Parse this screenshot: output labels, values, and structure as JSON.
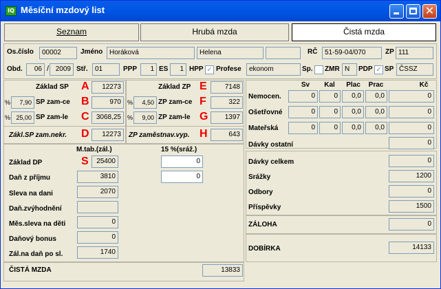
{
  "window": {
    "title": "Měsíční mzdový list",
    "icon_label": "IQ"
  },
  "tabs": [
    {
      "label": "Seznam"
    },
    {
      "label": "Hrubá mzda"
    },
    {
      "label": "Čistá mzda"
    }
  ],
  "employee": {
    "oscislo_label": "Os.číslo",
    "oscislo": "00002",
    "jmeno_label": "Jméno",
    "prijmeni": "Horáková",
    "jmeno": "Helena",
    "extra": "",
    "rc_label": "RČ",
    "rc": "51-59-04/070",
    "zp_label": "ZP",
    "zp": "111",
    "obd_label": "Obd.",
    "month": "06",
    "year": "2009",
    "str_label": "Stř.",
    "str": "01",
    "ppp_label": "PPP",
    "ppp": "1",
    "es_label": "ES",
    "es": "1",
    "hpp_label": "HPP",
    "hpp_checked": true,
    "profese_label": "Profese",
    "profese": "ekonom",
    "sp_label": "Sp.",
    "zmr_label": "ZMR",
    "zmr": "N",
    "pdp_label": "PDP",
    "sp2_label": "SP",
    "sp2": "ČSSZ"
  },
  "sp": {
    "zaklad_label": "Základ SP",
    "zaklad_letter": "A",
    "zaklad": "12273",
    "ce_pct": "7,90",
    "ce_label": "SP zam-ce",
    "ce_letter": "B",
    "ce": "970",
    "le_pct": "25,00",
    "le_label": "SP zam-le",
    "le_letter": "C",
    "le": "3068,25",
    "nekr_label": "Zákl.SP zam.nekr.",
    "nekr_letter": "D",
    "nekr": "12273"
  },
  "zp": {
    "zaklad_label": "Základ ZP",
    "zaklad_letter": "E",
    "zaklad": "7148",
    "ce_pct": "4,50",
    "ce_label": "ZP zam-ce",
    "ce_letter": "F",
    "ce": "322",
    "le_pct": "9,00",
    "le_label": "ZP zam-le",
    "le_letter": "G",
    "le": "1397",
    "vyp_label": "ZP zaměstnav.vyp.",
    "vyp_letter": "H",
    "vyp": "643"
  },
  "percent_symbol": "%",
  "davky": {
    "headers": [
      "Sv",
      "Kal",
      "Plac",
      "Prac",
      "Kč"
    ],
    "rows": [
      {
        "label": "Nemocen.",
        "values": [
          "0",
          "0",
          "0,0",
          "0,0",
          "0"
        ]
      },
      {
        "label": "Ošetřovné",
        "values": [
          "0",
          "0",
          "0,0",
          "0,0",
          "0"
        ]
      },
      {
        "label": "Mateřská",
        "values": [
          "0",
          "0",
          "0,0",
          "0,0",
          "0"
        ]
      }
    ],
    "ostatni_label": "Dávky ostatní",
    "ostatni": "0"
  },
  "tax": {
    "mtab_label": "M.tab.(zál.)",
    "sraz_label": "15 %(sráž.)",
    "zaklad_label": "Základ DP",
    "zaklad_letter": "S",
    "zaklad": "25400",
    "zaklad_sraz": "0",
    "dan_label": "Daň z příjmu",
    "dan": "3810",
    "dan_sraz": "0",
    "sleva_label": "Sleva na dani",
    "sleva": "2070",
    "zvyh_label": "Daň.zvýhodnění",
    "zvyh": "",
    "deti_label": "Měs.sleva na děti",
    "deti": "0",
    "bonus_label": "Daňový bonus",
    "bonus": "0",
    "zal_label": "Zál.na daň po sl.",
    "zal": "1740"
  },
  "summary": {
    "celkem_label": "Dávky celkem",
    "celkem": "0",
    "srazky_label": "Srážky",
    "srazky": "1200",
    "odbory_label": "Odbory",
    "odbory": "0",
    "prispevky_label": "Příspěvky",
    "prispevky": "1500",
    "zaloha_label": "ZÁLOHA",
    "zaloha": "0",
    "dobirka_label": "DOBÍRKA",
    "dobirka": "14133",
    "cista_label": "ČISTÁ MZDA",
    "cista": "13833"
  }
}
